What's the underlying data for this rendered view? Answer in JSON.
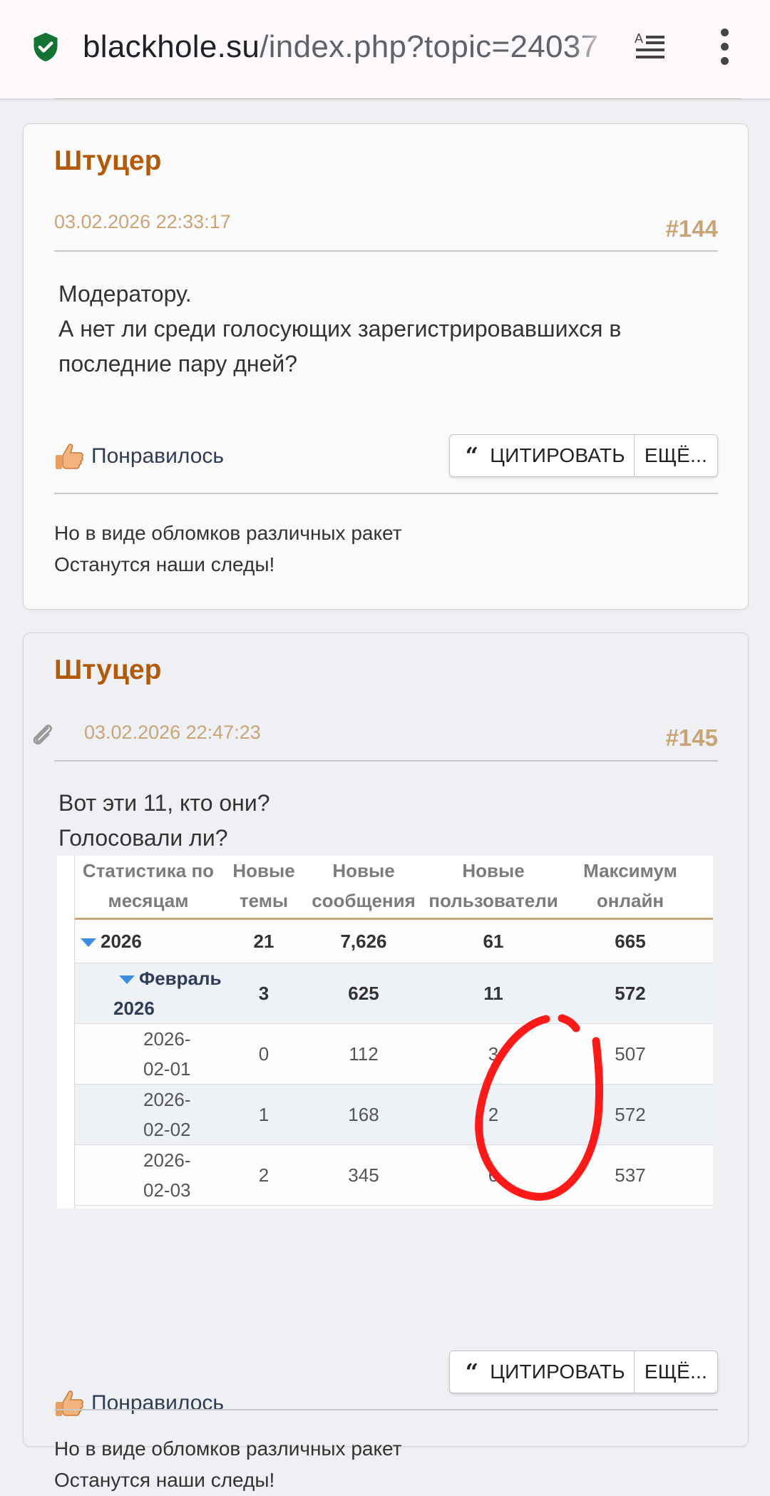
{
  "browser": {
    "url_host": "blackhole.su",
    "url_path": "/index.php?topic=24037"
  },
  "posts": [
    {
      "author": "Штуцер",
      "date": "03.02.2026 22:33:17",
      "number": "#144",
      "body": [
        "Модератору.",
        "А нет ли среди голосующих зарегистрировавшихся в",
        "последние пару дней?"
      ],
      "like_label": "Понравилось",
      "quote_label": "ЦИТИРОВАТЬ",
      "more_label": "ЕЩЁ...",
      "signature": [
        "Но в виде обломков различных ракет",
        "Останутся наши следы!"
      ]
    },
    {
      "author": "Штуцер",
      "date": "03.02.2026 22:47:23",
      "number": "#145",
      "body": [
        "Вот эти 11, кто они?",
        "Голосовали ли?"
      ],
      "like_label": "Понравилось",
      "quote_label": "ЦИТИРОВАТЬ",
      "more_label": "ЕЩЁ...",
      "signature": [
        "Но в виде обломков различных ракет",
        "Останутся наши следы!"
      ],
      "stats_table": {
        "headers": [
          [
            "Статистика по",
            "месяцам"
          ],
          [
            "Новые",
            "темы"
          ],
          [
            "Новые",
            "сообщения"
          ],
          [
            "Новые",
            "пользователи"
          ],
          [
            "Максимум",
            "онлайн"
          ]
        ],
        "rows": [
          {
            "label": [
              "2026"
            ],
            "values": [
              "21",
              "7,626",
              "61",
              "665"
            ]
          },
          {
            "label": [
              "Февраль",
              "2026"
            ],
            "values": [
              "3",
              "625",
              "11",
              "572"
            ]
          },
          {
            "label": [
              "2026-",
              "02-01"
            ],
            "values": [
              "0",
              "112",
              "3",
              "507"
            ]
          },
          {
            "label": [
              "2026-",
              "02-02"
            ],
            "values": [
              "1",
              "168",
              "2",
              "572"
            ]
          },
          {
            "label": [
              "2026-",
              "02-03"
            ],
            "values": [
              "2",
              "345",
              "6",
              "537"
            ]
          }
        ]
      }
    }
  ],
  "colors": {
    "author": "#b35a08",
    "meta": "#c9a476",
    "circle": "#ff1a1a"
  }
}
